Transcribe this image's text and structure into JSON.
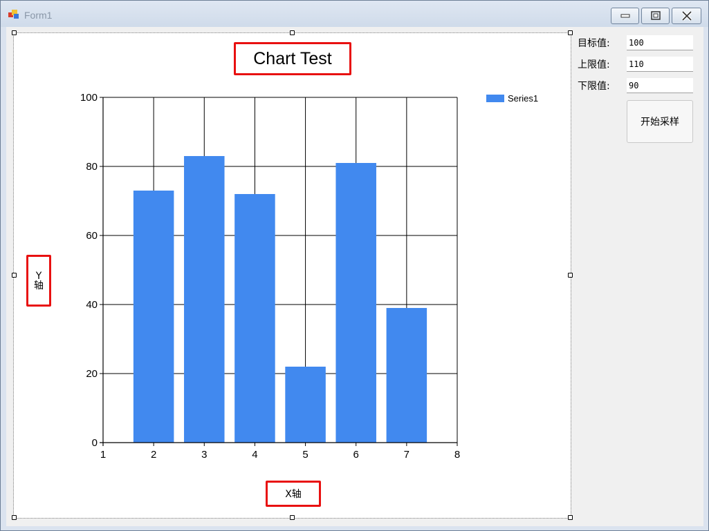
{
  "window": {
    "title": "Form1",
    "controls": {
      "minimize": "minimize",
      "maximize": "maximize",
      "close": "close"
    }
  },
  "chart": {
    "title": "Chart Test",
    "y_axis_label_line1": "Y",
    "y_axis_label_line2": "轴",
    "x_axis_label": "X轴",
    "legend_label": "Series1"
  },
  "side_panel": {
    "target_label": "目标值:",
    "target_value": "100",
    "upper_label": "上限值:",
    "upper_value": "110",
    "lower_label": "下限值:",
    "lower_value": "90",
    "start_button": "开始采样"
  },
  "chart_data": {
    "type": "bar",
    "title": "Chart Test",
    "xlabel": "X轴",
    "ylabel": "Y轴",
    "x": [
      2,
      3,
      4,
      5,
      6,
      7
    ],
    "series": [
      {
        "name": "Series1",
        "values": [
          73,
          83,
          72,
          22,
          81,
          39
        ],
        "color": "#4189ef"
      }
    ],
    "xlim": [
      1,
      8
    ],
    "ylim": [
      0,
      100
    ],
    "xticks": [
      1,
      2,
      3,
      4,
      5,
      6,
      7,
      8
    ],
    "yticks": [
      0,
      20,
      40,
      60,
      80,
      100
    ],
    "grid": true,
    "legend_position": "top-right"
  }
}
